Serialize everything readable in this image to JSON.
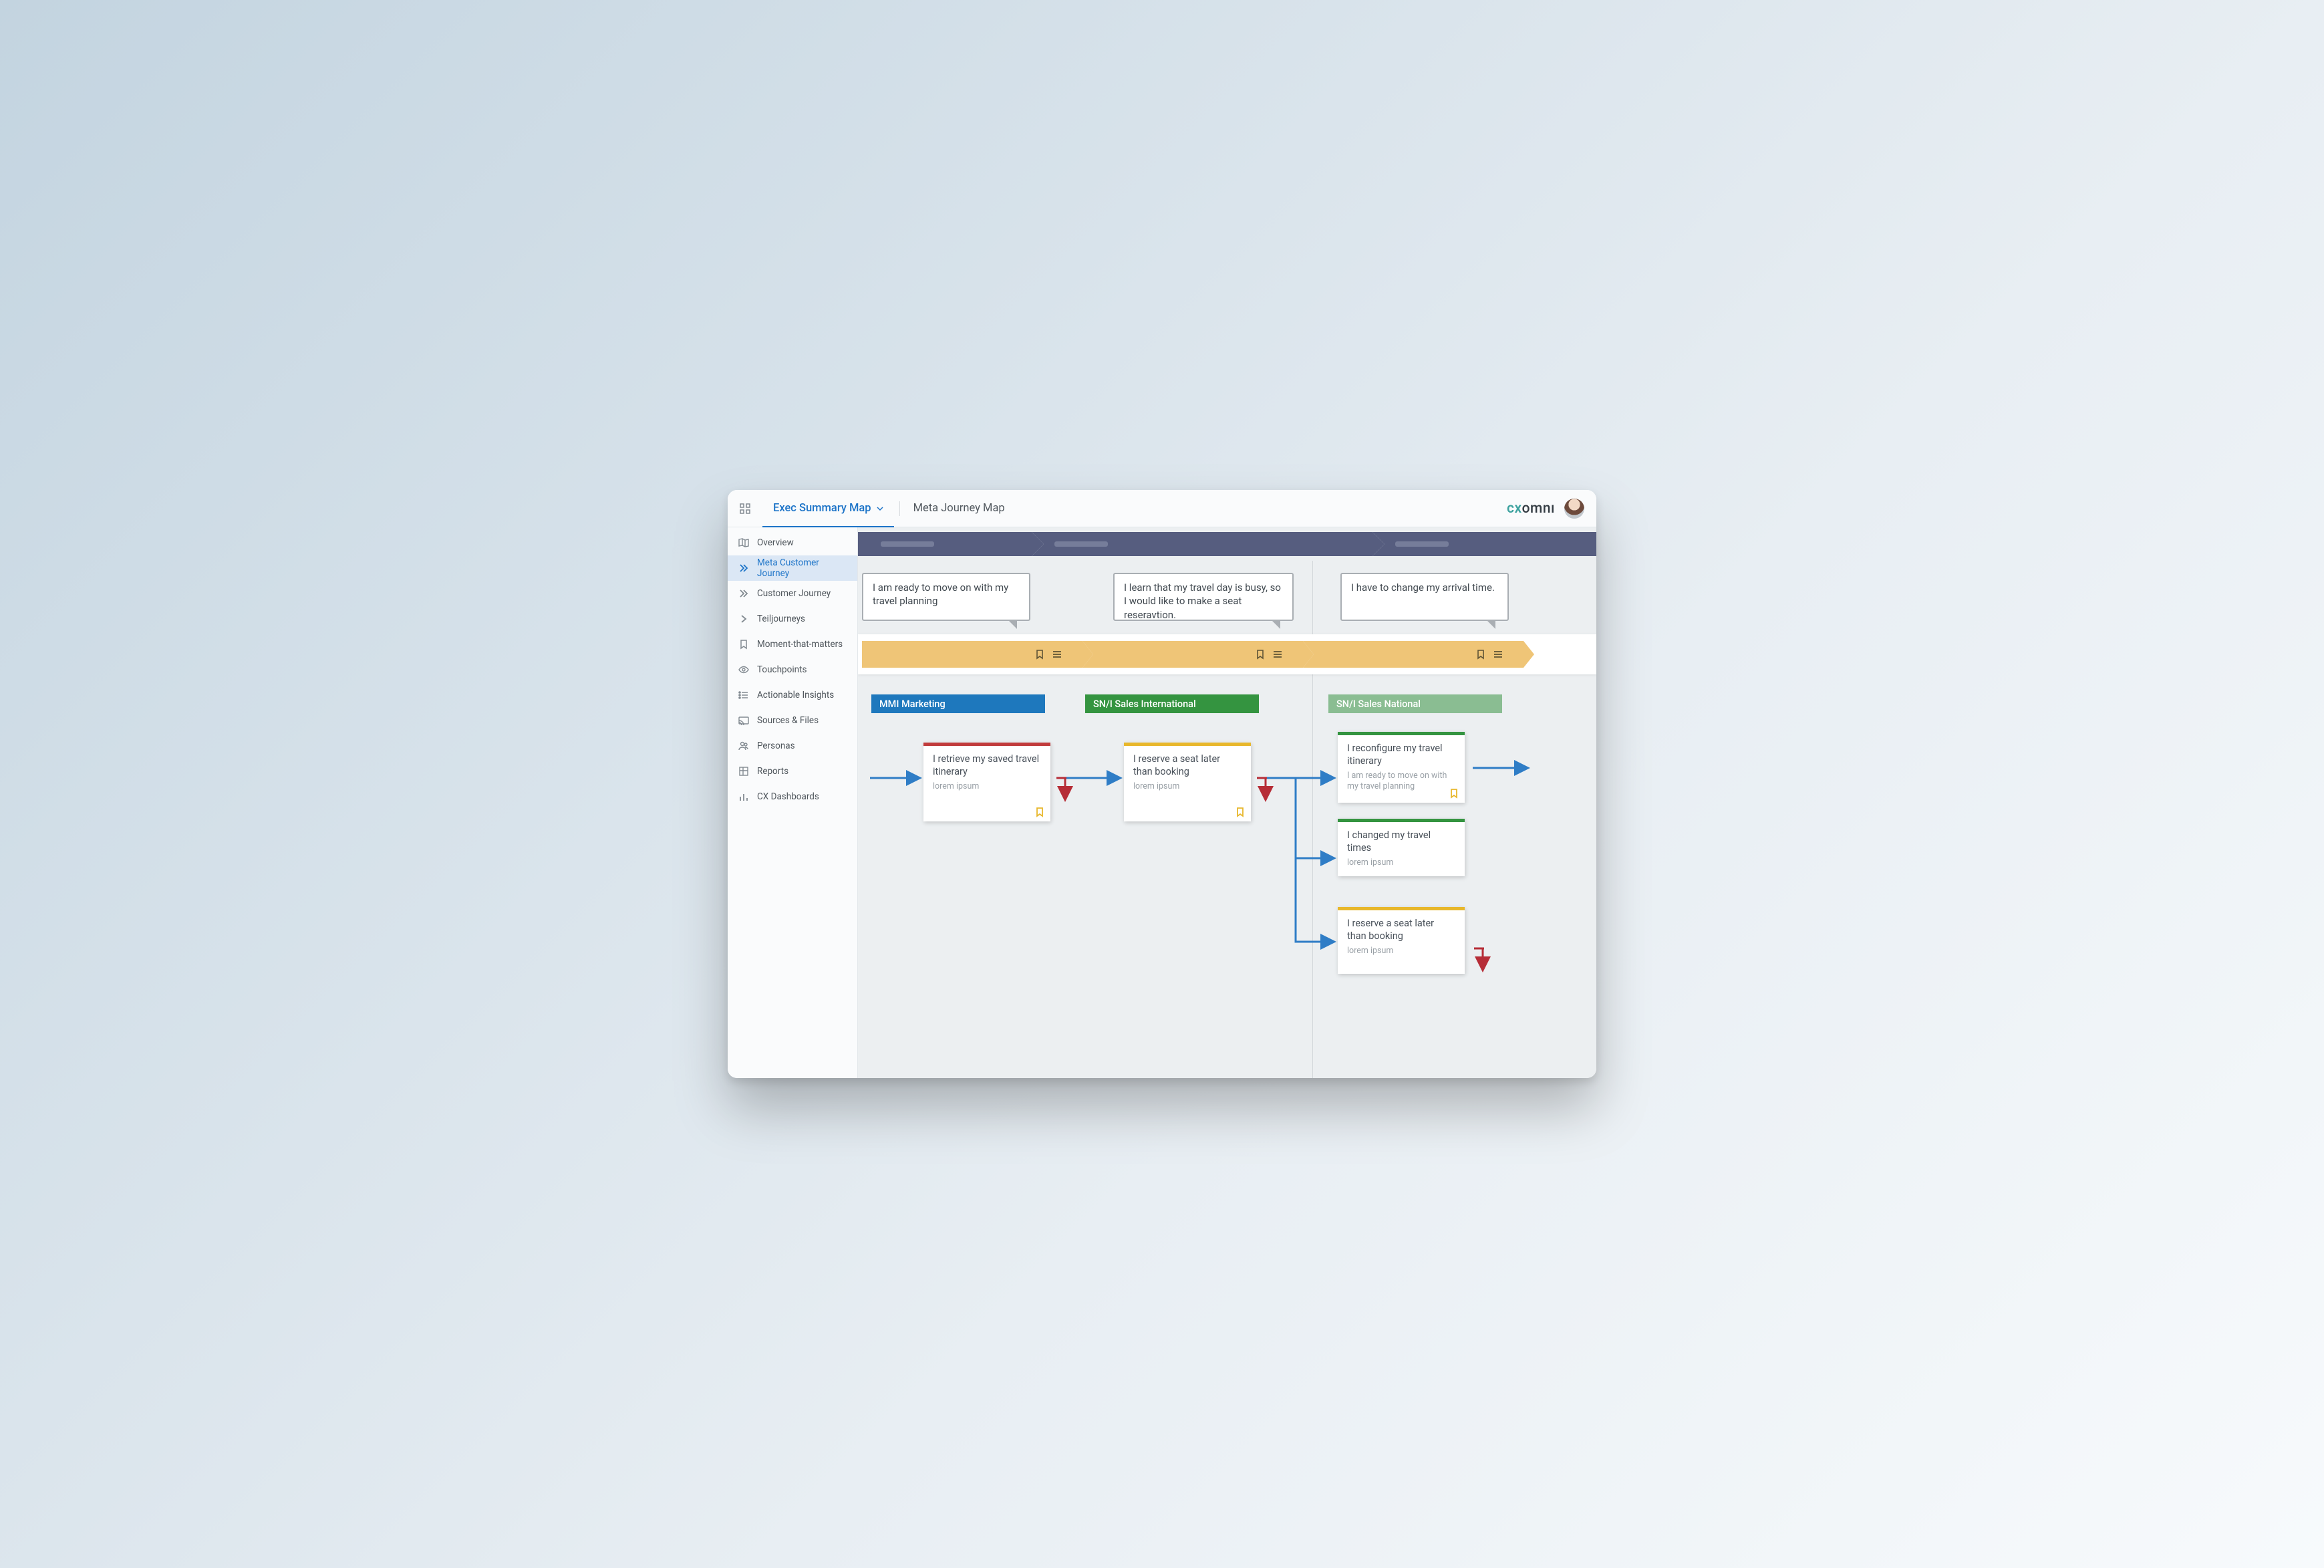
{
  "header": {
    "tab_active": "Exec Summary Map",
    "tab_secondary": "Meta Journey Map",
    "brand_cx": "cx",
    "brand_omni": "omnı"
  },
  "sidebar": {
    "items": [
      {
        "label": "Overview",
        "icon": "map-icon"
      },
      {
        "label": "Meta Customer Journey",
        "icon": "chevrons-right-icon"
      },
      {
        "label": "Customer Journey",
        "icon": "chevrons-right-icon"
      },
      {
        "label": "Teiljourneys",
        "icon": "chevron-right-icon"
      },
      {
        "label": "Moment-that-matters",
        "icon": "bookmark-icon"
      },
      {
        "label": "Touchpoints",
        "icon": "eye-icon"
      },
      {
        "label": "Actionable Insights",
        "icon": "list-icon"
      },
      {
        "label": "Sources & Files",
        "icon": "cast-icon"
      },
      {
        "label": "Personas",
        "icon": "users-icon"
      },
      {
        "label": "Reports",
        "icon": "grid-icon"
      },
      {
        "label": "CX Dashboards",
        "icon": "bar-chart-icon"
      }
    ],
    "selected_index": 1
  },
  "bubbles": {
    "b1": "I am ready to move on with my travel planning",
    "b2": "I learn that my travel day is busy, so I would like to make a seat reseravtion.",
    "b3": "I have to change my arrival time."
  },
  "categories": {
    "c1": "MMI Marketing",
    "c2": "SN/I Sales International",
    "c3": "SN/I Sales National"
  },
  "cards": {
    "card1": {
      "title": "I retrieve my saved travel itinerary",
      "sub": "lorem ipsum"
    },
    "card2": {
      "title": "I reserve a seat later than booking",
      "sub": "lorem ipsum"
    },
    "card3": {
      "title": "I reconfigure my travel itinerary",
      "sub": "I am ready to move on with my travel planning"
    },
    "card4": {
      "title": "I changed my travel times",
      "sub": "lorem ipsum"
    },
    "card5": {
      "title": "I reserve a seat later than booking",
      "sub": "lorem ipsum"
    }
  },
  "colors": {
    "phase": "#565d7f",
    "stage": "#efc577",
    "primary": "#1d74c8",
    "cat_blue": "#1e78bd",
    "cat_green": "#349440",
    "cat_lightgreen": "#8abd92",
    "arrow_blue": "#2f7dc6",
    "arrow_red": "#b62d37"
  }
}
